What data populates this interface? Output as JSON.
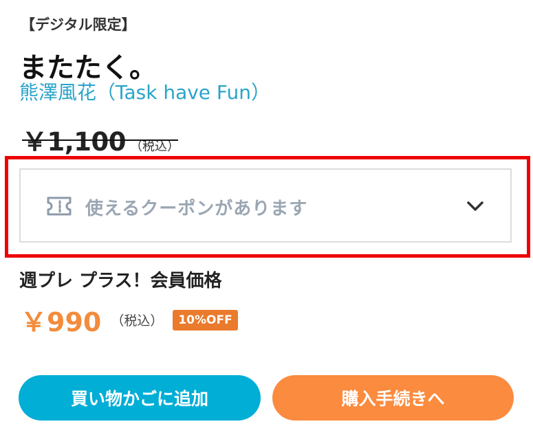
{
  "product": {
    "tag": "【デジタル限定】",
    "title": "またたく。",
    "author": "熊澤風花（Task have Fun）",
    "original_price": "￥1,100",
    "original_price_tax": "（税込）"
  },
  "coupon": {
    "label": "使えるクーポンがあります",
    "icon": "ticket-icon",
    "expand_icon": "chevron-down-icon"
  },
  "member": {
    "label": "週プレ プラス！会員価格",
    "price": "￥990",
    "price_tax": "（税込）",
    "discount": "10%OFF"
  },
  "actions": {
    "add_to_cart": "買い物かごに追加",
    "checkout": "購入手続きへ"
  },
  "colors": {
    "author_link": "#2aa4c9",
    "member_price": "#f28c3c",
    "discount_badge": "#ea7a2c",
    "cart_button": "#00aed6",
    "checkout_button": "#fb8b3e",
    "highlight": "#ee0000"
  }
}
